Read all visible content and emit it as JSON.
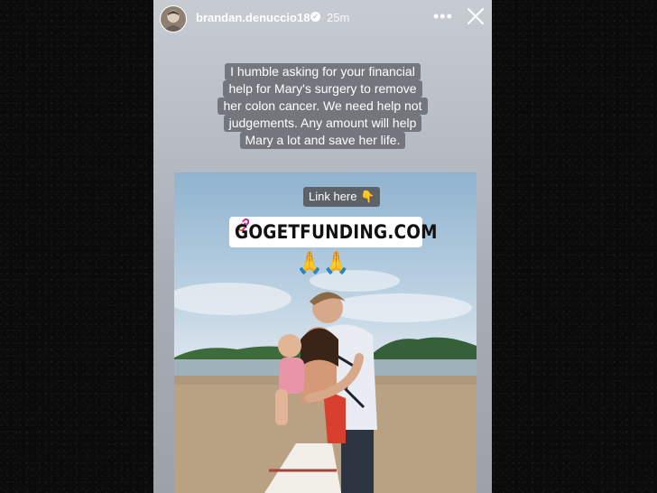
{
  "story": {
    "username": "brandan.denuccio18",
    "verified_icon": "verified-badge-icon",
    "time": "25m",
    "more_icon": "more-options-icon",
    "close_icon": "close-icon"
  },
  "caption": {
    "lines": [
      "I humble asking for your financial",
      "help for Mary's surgery to remove",
      "her colon cancer. We need help not",
      "judgements. Any amount will help",
      "Mary a lot and save her life."
    ]
  },
  "stickers": {
    "link_here": "Link here 👇",
    "link_icon": "link-icon",
    "link_text": "GOGETFUNDING.COM",
    "emoji": "🙏🙏"
  },
  "colors": {
    "link_icon_gradient": [
      "#f58529",
      "#dd2a7b",
      "#8134af"
    ]
  }
}
